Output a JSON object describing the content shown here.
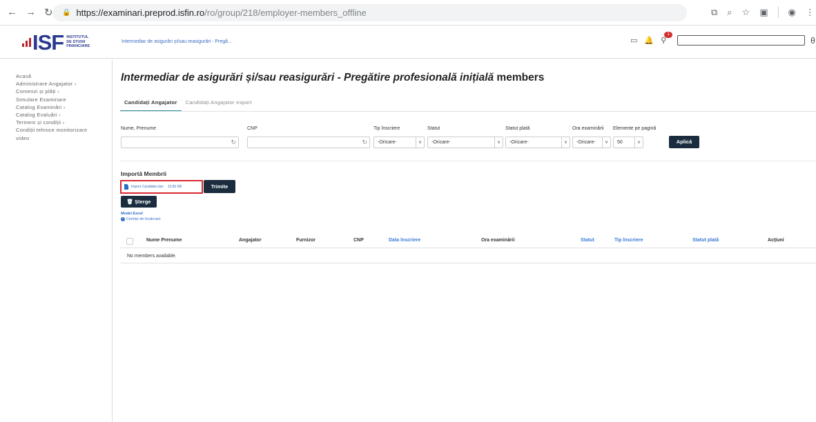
{
  "browser": {
    "url_host": "https://examinari.preprod.isfin.ro",
    "url_path": "/ro/group/218/employer-members_offline"
  },
  "header": {
    "logo_mark": "ISF",
    "logo_text_1": "INSTITUTUL",
    "logo_text_2": "DE STUDII",
    "logo_text_3": "FINANCIARE",
    "breadcrumb": "Intermediar de asigurări și/sau reasigurări - Pregă...",
    "cart_count": "1"
  },
  "sidebar": {
    "items": [
      {
        "label": "Acasă"
      },
      {
        "label": "Administrare Angajator ›"
      },
      {
        "label": "Comenzi și plăți ›"
      },
      {
        "label": "Simulare Examinare"
      },
      {
        "label": "Catalog Examinări ›"
      },
      {
        "label": "Catalog Evaluări ›"
      },
      {
        "label": "Termeni și condiții ›"
      },
      {
        "label": "Condiții tehnice monitorizare"
      },
      {
        "label": "video"
      }
    ]
  },
  "main": {
    "title_italic": "Intermediar de asigurări și/sau reasigurări - Pregătire profesională inițială",
    "title_plain": " members",
    "tabs": [
      {
        "label": "Candidați Angajator"
      },
      {
        "label": "Candidați Angajator export"
      }
    ],
    "filters": {
      "name_label": "Nume, Prenume",
      "cnp_label": "CNP",
      "tip_label": "Tip înscriere",
      "statut_label": "Statut",
      "statut_plata_label": "Statut plată",
      "ora_label": "Ora examinării",
      "elemente_label": "Elemente pe pagină",
      "tip_value": "-Oricare-",
      "statut_value": "-Oricare-",
      "statut_plata_value": "-Oricare-",
      "ora_value": "-Oricare-",
      "elemente_value": "50",
      "apply_label": "Aplică"
    },
    "import": {
      "title": "Importă Membrii",
      "file_name": "Import Candidati.xlsx",
      "file_size": "13.65 KB",
      "send_label": "Trimite",
      "delete_label": "Șterge",
      "delete_icon": "🗑",
      "model_link": "Model Excel",
      "requirements_link": "Cerințe de încărcare"
    },
    "table": {
      "columns": [
        "Nume Prenume",
        "Angajator",
        "Furnizor",
        "CNP",
        "Data înscriere",
        "Ora examinării",
        "Statut",
        "Tip înscriere",
        "Statut plată",
        "Acțiuni"
      ],
      "empty_message": "No members available."
    }
  }
}
